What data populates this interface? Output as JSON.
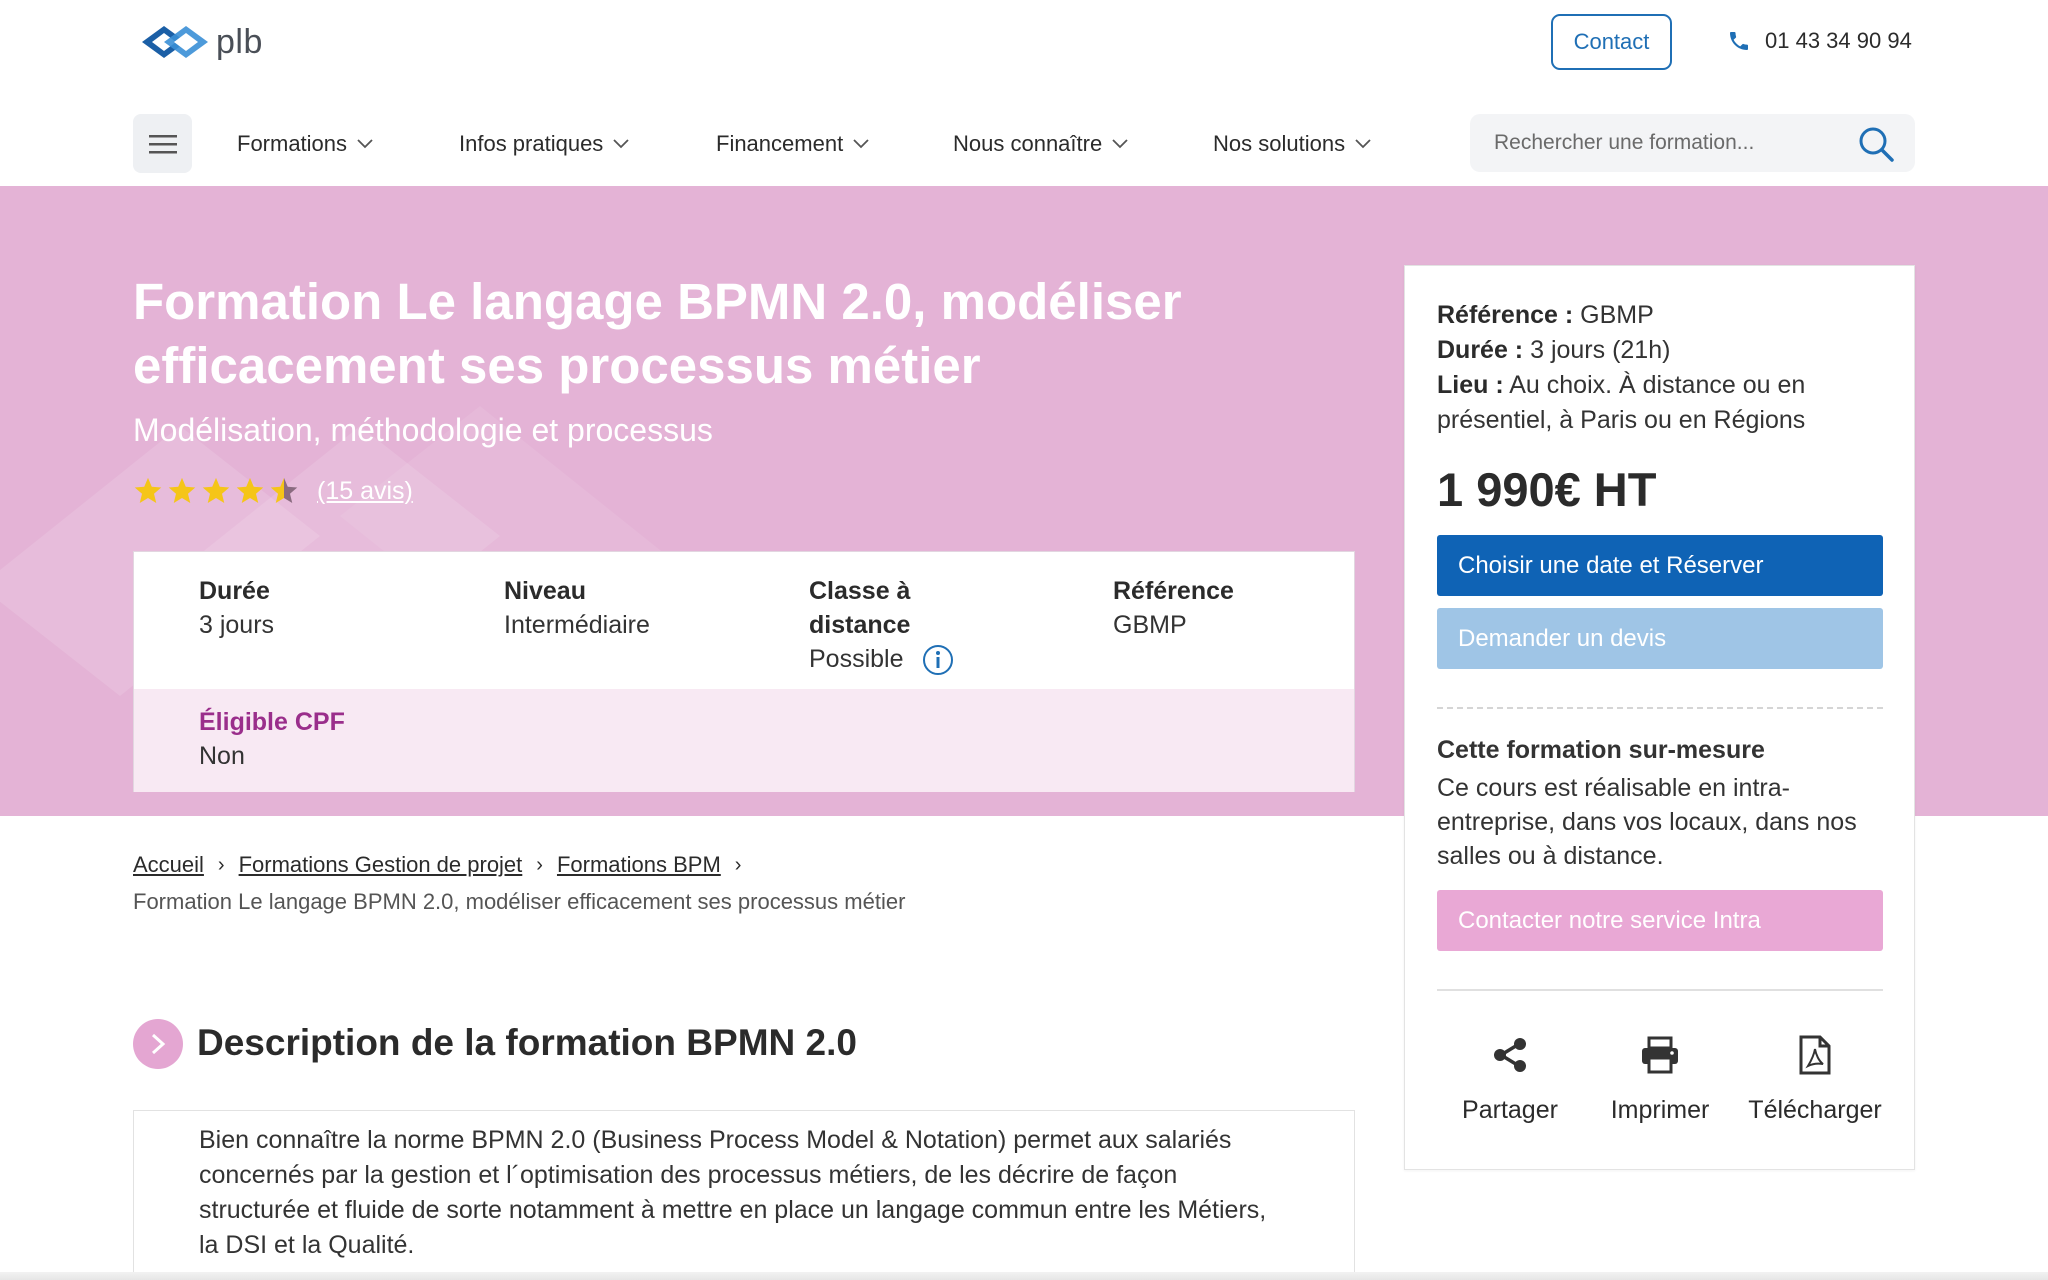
{
  "header": {
    "logo_text": "plb",
    "contact_label": "Contact",
    "phone": "01 43 34 90 94",
    "nav": [
      {
        "label": "Formations"
      },
      {
        "label": "Infos pratiques"
      },
      {
        "label": "Financement"
      },
      {
        "label": "Nous connaître"
      },
      {
        "label": "Nos solutions"
      }
    ],
    "search_placeholder": "Rechercher une formation..."
  },
  "hero": {
    "title": "Formation Le langage BPMN 2.0, modéliser efficacement ses processus métier",
    "subtitle": "Modélisation, méthodologie et processus",
    "rating": 4.5,
    "reviews": "(15 avis)",
    "accent_color": "#e4b3d6"
  },
  "facts": {
    "duree_label": "Durée",
    "duree_value": "3 jours",
    "niveau_label": "Niveau",
    "niveau_value": "Intermédiaire",
    "classe_label": "Classe à distance",
    "classe_value": "Possible",
    "reference_label": "Référence",
    "reference_value": "GBMP",
    "cpf_label": "Éligible CPF",
    "cpf_value": "Non"
  },
  "card": {
    "ref_label": "Référence :",
    "ref_value": "GBMP",
    "duree_label": "Durée :",
    "duree_value": "3 jours (21h)",
    "lieu_label": "Lieu :",
    "lieu_value": "Au choix. À distance ou en présentiel, à Paris ou en Régions",
    "price": "1 990€ HT",
    "book_label": "Choisir une date et Réserver",
    "devis_label": "Demander un devis",
    "custom_title": "Cette formation sur-mesure",
    "custom_text": "Ce cours est réalisable en intra-entreprise, dans vos locaux, dans nos salles ou à distance.",
    "intra_label": "Contacter notre service Intra",
    "actions": [
      {
        "label": "Partager",
        "icon": "share-icon"
      },
      {
        "label": "Imprimer",
        "icon": "print-icon"
      },
      {
        "label": "Télécharger",
        "icon": "pdf-icon"
      }
    ]
  },
  "breadcrumb": {
    "items": [
      "Accueil",
      "Formations Gestion de projet",
      "Formations BPM"
    ],
    "current": "Formation Le langage BPMN 2.0, modéliser efficacement ses processus métier"
  },
  "description": {
    "title": "Description de la formation BPMN 2.0",
    "text": "Bien connaître la norme BPMN 2.0 (Business Process Model & Notation) permet aux salariés concernés par la gestion et l´optimisation des processus métiers, de les décrire de façon structurée et fluide de sorte notamment à mettre en place un langage commun entre les Métiers, la DSI et la Qualité."
  }
}
